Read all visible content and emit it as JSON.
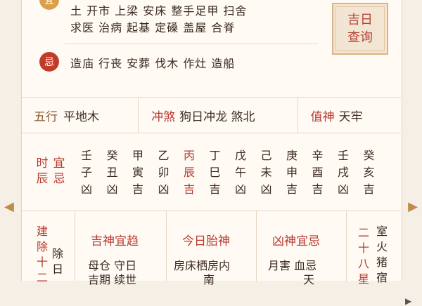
{
  "yi": {
    "badge": "宜",
    "line1": "土 开市 上梁 安床 整手足甲 扫舍",
    "line2": "求医 治病 起基 定磉 盖屋 合脊"
  },
  "ji": {
    "badge": "忌",
    "line": "造庙 行丧 安葬 伐木 作灶 造船"
  },
  "query_button": {
    "line1": "吉日",
    "line2": "查询"
  },
  "info_row": {
    "wuxing_label": "五行",
    "wuxing_value": "平地木",
    "chongsha_label": "冲煞",
    "chongsha_value": "狗日冲龙 煞北",
    "zhishen_label": "值神",
    "zhishen_value": "天牢"
  },
  "hours": {
    "label_col1": [
      "时",
      "辰"
    ],
    "label_col2": [
      "宜",
      "忌"
    ],
    "items": [
      {
        "gan": "壬",
        "zhi": "子",
        "jx": "凶"
      },
      {
        "gan": "癸",
        "zhi": "丑",
        "jx": "凶"
      },
      {
        "gan": "甲",
        "zhi": "寅",
        "jx": "吉"
      },
      {
        "gan": "乙",
        "zhi": "卯",
        "jx": "凶"
      },
      {
        "gan": "丙",
        "zhi": "辰",
        "jx": "吉"
      },
      {
        "gan": "丁",
        "zhi": "巳",
        "jx": "吉"
      },
      {
        "gan": "戊",
        "zhi": "午",
        "jx": "凶"
      },
      {
        "gan": "己",
        "zhi": "未",
        "jx": "凶"
      },
      {
        "gan": "庚",
        "zhi": "申",
        "jx": "吉"
      },
      {
        "gan": "辛",
        "zhi": "酉",
        "jx": "吉"
      },
      {
        "gan": "壬",
        "zhi": "戌",
        "jx": "凶"
      },
      {
        "gan": "癸",
        "zhi": "亥",
        "jx": "吉"
      }
    ]
  },
  "bottom": {
    "jianchu_col1": [
      "建",
      "除",
      "十",
      "二"
    ],
    "jianchu_col2": [
      "除",
      "日"
    ],
    "jishen_title": "吉神宜趋",
    "jishen_text": "母仓 守日",
    "jishen_text2": "吉期 续世",
    "taishen_title": "今日胎神",
    "taishen_text": "房床栖房内",
    "taishen_text2": "南",
    "xiongshen_title": "凶神宜忌",
    "xiongshen_text": "月害 血忌",
    "xiongshen_text2": "天",
    "xiu_col1": [
      "二",
      "十",
      "八",
      "星"
    ],
    "xiu_col2": [
      "室",
      "火",
      "猪",
      "宿"
    ]
  },
  "colors": {
    "accent_red": "#b93a2f",
    "accent_gold": "#d8a04a",
    "background": "#fffaf4"
  }
}
